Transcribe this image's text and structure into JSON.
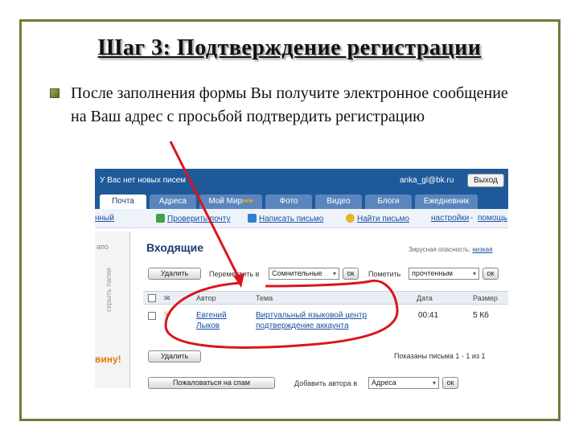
{
  "slide": {
    "title": "Шаг 3: Подтверждение регистрации",
    "bullet": "После заполнения формы Вы получите электронное сообщение на Ваш адрес с просьбой подтвердить регистрацию"
  },
  "mail": {
    "header": {
      "message": "У Вас нет новых писем",
      "user": "anka_gl@bk.ru",
      "exit_button": "Выход"
    },
    "tabs": [
      {
        "label": "Почта"
      },
      {
        "label": "Адреса"
      },
      {
        "label": "Мой Мир",
        "badge": "new"
      },
      {
        "label": "Фото"
      },
      {
        "label": "Видео"
      },
      {
        "label": "Блоги"
      },
      {
        "label": "Ежедневник"
      }
    ],
    "toolbar": {
      "partial_left": "нный",
      "check": "Проверить почту",
      "write": "Написать письмо",
      "find": "Найти письмо",
      "settings": "настройки",
      "dash": "-",
      "help": "помощь"
    },
    "sidebar": {
      "partial_top": "апо",
      "vertical": "скрыть папки",
      "promo": "вину!"
    },
    "folder": {
      "title": "Входящие",
      "spam_label": "Зирусная опасность:",
      "spam_value": "низкая",
      "delete_button": "Удалить",
      "move_label": "Переместить в",
      "move_select": "Сомнительные",
      "ok": "ок",
      "mark_label": "Пометить",
      "mark_select": "прочтенным"
    },
    "table": {
      "headers": {
        "author": "Автор",
        "subject": "Тема",
        "date": "Дата",
        "size": "Размер"
      },
      "rows": [
        {
          "author_line1": "Евгений",
          "author_line2": "Лыков",
          "subject_line1": "Виртуальный языковой центр",
          "subject_line2": "подтверждение аккаунта",
          "date": "00:41",
          "size": "5 Кб"
        }
      ]
    },
    "bottom": {
      "delete_button": "Удалить",
      "shown": "Показаны письма 1 - 1 из 1",
      "spam_button": "Пожаловаться на спам",
      "add_author_label": "Добавить автора в",
      "add_author_select": "Адреса",
      "ok": "ок"
    }
  },
  "colors": {
    "frame": "#6b7d3a",
    "header_blue": "#1e5a9a",
    "annotation_red": "#d9161c"
  }
}
